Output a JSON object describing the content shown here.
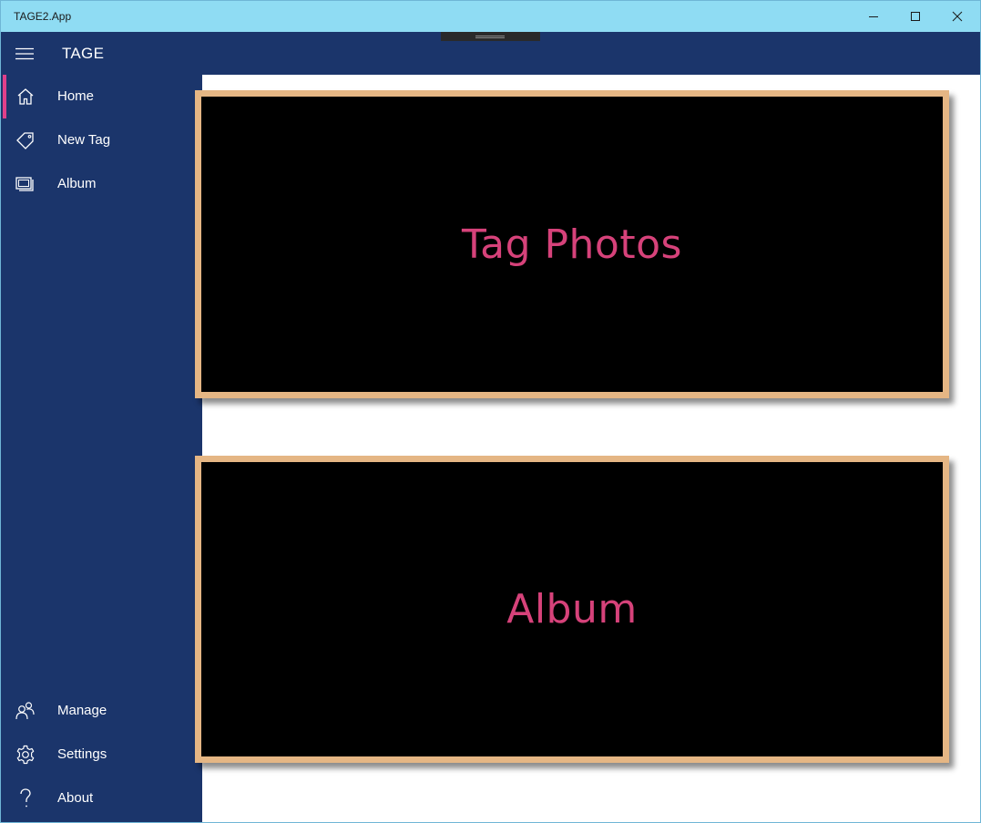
{
  "window": {
    "title": "TAGE2.App"
  },
  "app": {
    "title": "TAGE"
  },
  "nav": {
    "top_items": [
      {
        "label": "Home",
        "icon": "home-icon",
        "active": true
      },
      {
        "label": "New Tag",
        "icon": "tag-icon",
        "active": false
      },
      {
        "label": "Album",
        "icon": "album-icon",
        "active": false
      }
    ],
    "bottom_items": [
      {
        "label": "Manage",
        "icon": "people-icon"
      },
      {
        "label": "Settings",
        "icon": "gear-icon"
      },
      {
        "label": "About",
        "icon": "question-icon"
      }
    ]
  },
  "tiles": {
    "tag_photos": "Tag Photos",
    "album": "Album"
  },
  "colors": {
    "titlebar": "#8fdcf3",
    "sidebar": "#1b356b",
    "accent": "#e0408a",
    "tile_border": "#e5b684",
    "tile_text": "#d6427a"
  }
}
